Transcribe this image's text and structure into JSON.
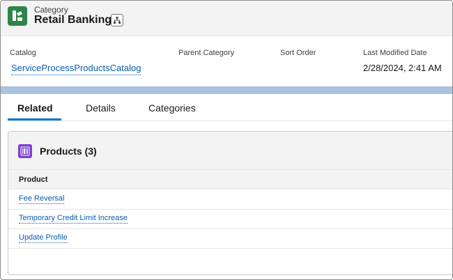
{
  "header": {
    "object_type": "Category",
    "record_title": "Retail Banking"
  },
  "highlights": {
    "fields": [
      {
        "label": "Catalog",
        "value": "ServiceProcessProductsCatalog"
      },
      {
        "label": "Parent Category",
        "value": ""
      },
      {
        "label": "Sort Order",
        "value": ""
      },
      {
        "label": "Last Modified Date",
        "value": "2/28/2024, 2:41 AM"
      }
    ]
  },
  "tabs": [
    {
      "label": "Related",
      "active": true
    },
    {
      "label": "Details",
      "active": false
    },
    {
      "label": "Categories",
      "active": false
    }
  ],
  "products_card": {
    "title": "Products (3)",
    "column_header": "Product",
    "rows": [
      "Fee Reversal",
      "Temporary Credit Limit Increase",
      "Update Profile"
    ]
  },
  "colors": {
    "app_icon": "#2e844a",
    "card_icon": "#7f3fd0",
    "link": "#0b5cab",
    "active_tab": "#0176d3",
    "band": "#a9c2df"
  }
}
